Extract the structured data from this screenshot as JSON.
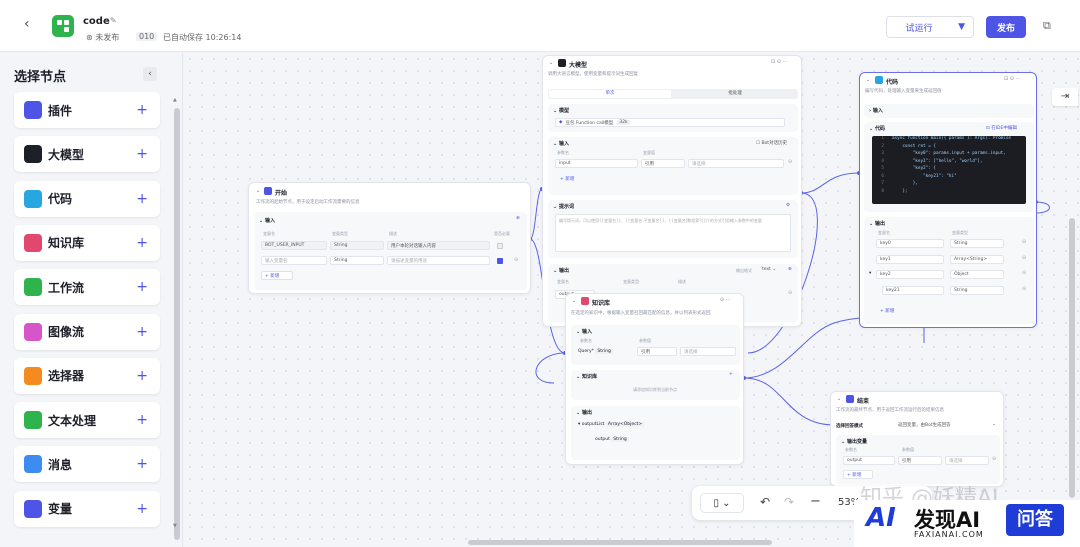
{
  "header": {
    "title": "code",
    "status": "未发布",
    "version": "010",
    "autosave": "已自动保存 10:26:14",
    "test_run": "试运行",
    "publish": "发布"
  },
  "sidebar": {
    "title": "选择节点",
    "items": [
      {
        "label": "插件",
        "icon": "plugin-icon",
        "color": "#4e55e6"
      },
      {
        "label": "大模型",
        "icon": "llm-icon",
        "color": "#1d1f29"
      },
      {
        "label": "代码",
        "icon": "code-icon",
        "color": "#26a7e0"
      },
      {
        "label": "知识库",
        "icon": "knowledge-icon",
        "color": "#e0486d"
      },
      {
        "label": "工作流",
        "icon": "workflow-icon",
        "color": "#2fb34d"
      },
      {
        "label": "图像流",
        "icon": "imageflow-icon",
        "color": "#d656c9"
      },
      {
        "label": "选择器",
        "icon": "selector-icon",
        "color": "#f58a1f"
      },
      {
        "label": "文本处理",
        "icon": "text-icon",
        "color": "#2fb34d"
      },
      {
        "label": "消息",
        "icon": "message-icon",
        "color": "#3d8df0"
      },
      {
        "label": "变量",
        "icon": "variable-icon",
        "color": "#4e55e6"
      }
    ]
  },
  "start": {
    "title": "开始",
    "desc": "工作流的起始节点，用于设定启动工作流需要的信息",
    "input": "输入",
    "cols": [
      "变量名",
      "变量类型",
      "描述",
      "是否必要"
    ],
    "rows": [
      {
        "name": "BOT_USER_INPUT",
        "type": "String",
        "desc": "用户本轮对话输入内容"
      },
      {
        "name": "输入变量名",
        "type": "String",
        "desc": "请描述变量的用途"
      }
    ],
    "add": "+ 新增"
  },
  "llm": {
    "title": "大模型",
    "desc": "调用大语言模型，使用变量和提示词生成回复",
    "tabs": [
      "单次",
      "批处理"
    ],
    "model_label": "模型",
    "model": "豆包 Function call模型",
    "model_tag": "32k",
    "input": "输入",
    "history": "Bot对话历史",
    "cols": [
      "参数名",
      "变量值"
    ],
    "param": "input",
    "ref": "引用",
    "sel": "请选择",
    "add": "+ 新增",
    "prompt": "提示词",
    "prompt_ph": "编写提示词，可以使用{{变量名}}、{{变量名.子变量名}}、{{变量名[数组索引]}}的方式引用输入参数中的变量",
    "output": "输出",
    "output_fmt": "输出格式",
    "fmt": "text",
    "out_cols": [
      "变量名",
      "变量类型",
      "描述"
    ],
    "out_name": "output"
  },
  "code": {
    "title": "代码",
    "desc": "编写代码，处理输入变量来生成返回值",
    "input": "输入",
    "code": "代码",
    "ide": "在IDE中编辑",
    "lines": [
      "async function main({ params }: Args): Promise",
      "    const ret = {",
      "        \"key0\": params.input + params.input,",
      "        \"key1\": [\"hello\", \"world\"],",
      "        \"key2\": {",
      "            \"key21\": \"hi\"",
      "        },",
      "    };"
    ],
    "output": "输出",
    "cols": [
      "变量名",
      "变量类型"
    ],
    "outs": [
      {
        "name": "key0",
        "type": "String"
      },
      {
        "name": "key1",
        "type": "Array<String>"
      },
      {
        "name": "key2",
        "type": "Object"
      },
      {
        "name": "key21",
        "type": "String"
      }
    ],
    "add": "+ 新增"
  },
  "knowledge": {
    "title": "知识库",
    "desc": "在选定的知识中，根据输入变量召回最匹配的信息，并以列表形式返回",
    "input": "输入",
    "cols": [
      "参数名",
      "参数值"
    ],
    "param": "Query",
    "ptype": "String",
    "ref": "引用",
    "sel": "请选择",
    "kb": "知识库",
    "kb_ph": "请添加知识库到当前节点",
    "output": "输出",
    "out1": "outputList",
    "out1t": "Array<Object>",
    "out2": "output",
    "out2t": "String"
  },
  "end": {
    "title": "结束",
    "desc": "工作流的最终节点，用于返回工作流运行后的结果信息",
    "mode": "选择回答模式",
    "mode_val": "返回变量，由Bot生成回答",
    "vars": "输出变量",
    "cols": [
      "参数名",
      "参数值"
    ],
    "param": "output",
    "ref": "引用",
    "sel": "请选择",
    "add": "+ 新增"
  },
  "toolbar": {
    "zoom": "53%"
  },
  "watermark": {
    "text": "知乎 @妖精AI",
    "brand": "发现AI",
    "brand_url": "FAXIANAI.COM",
    "qa": "问答"
  }
}
